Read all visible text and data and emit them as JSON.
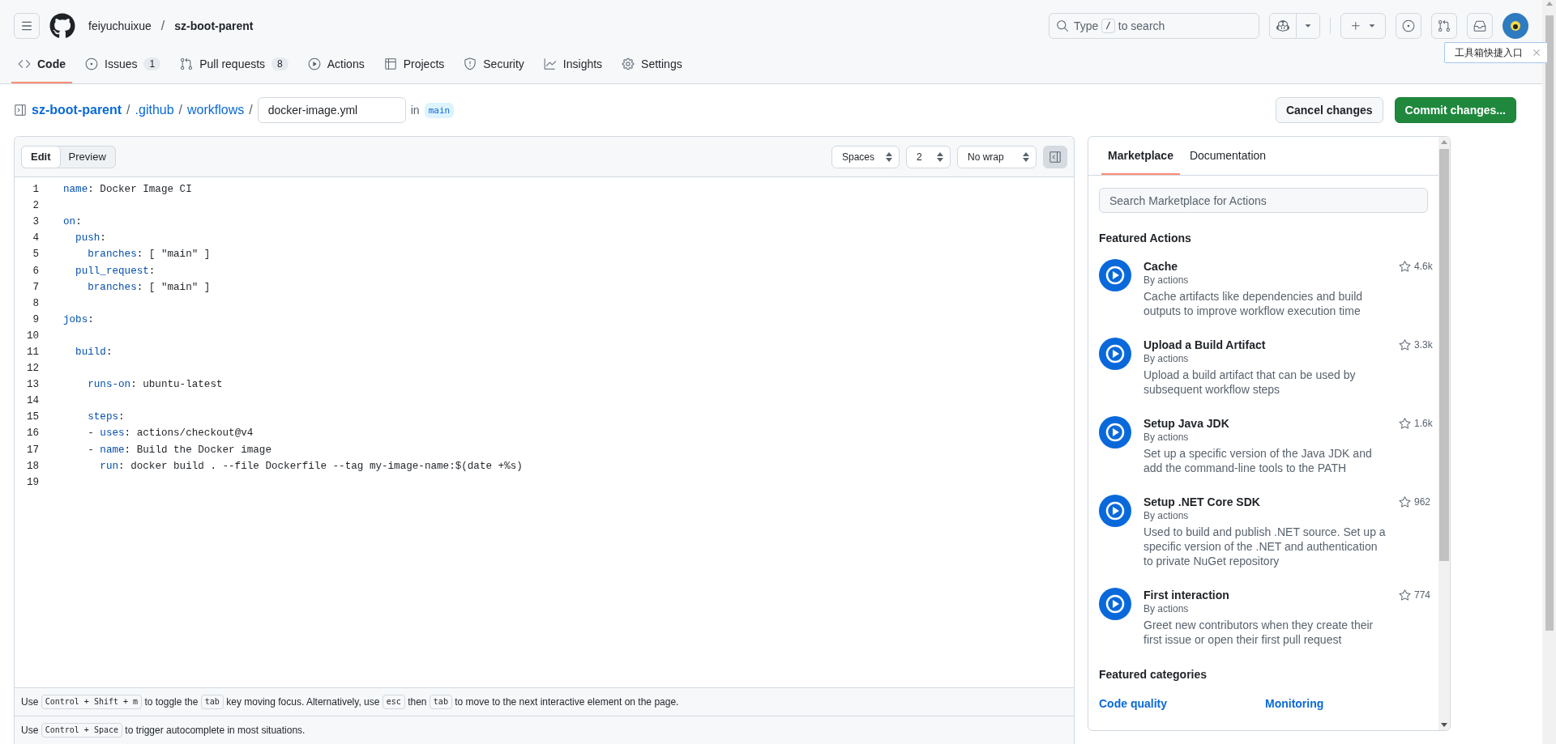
{
  "header": {
    "owner": "feiyuchuixue",
    "separator": "/",
    "repo": "sz-boot-parent",
    "search": {
      "placeholder_parts": [
        {
          "kind": "text",
          "text": "Type "
        },
        {
          "kind": "kbd",
          "text": "/"
        },
        {
          "kind": "text",
          "text": " to search"
        }
      ]
    }
  },
  "tooltip": {
    "text": "工具箱快捷入口"
  },
  "nav": [
    {
      "label": "Code",
      "selected": true
    },
    {
      "label": "Issues",
      "count": "1",
      "selected": false
    },
    {
      "label": "Pull requests",
      "count": "8",
      "selected": false
    },
    {
      "label": "Actions",
      "selected": false
    },
    {
      "label": "Projects",
      "selected": false
    },
    {
      "label": "Security",
      "selected": false
    },
    {
      "label": "Insights",
      "selected": false
    },
    {
      "label": "Settings",
      "selected": false
    }
  ],
  "breadcrumb": {
    "parts": [
      "sz-boot-parent",
      "/",
      ".github",
      "/",
      "workflows",
      "/"
    ],
    "filename": "docker-image.yml",
    "in_label": "in",
    "branch": "main"
  },
  "actions_buttons": [
    {
      "label": "Cancel changes",
      "kind": "default"
    },
    {
      "label": "Commit changes...",
      "kind": "primary"
    }
  ],
  "editor": {
    "modes": [
      {
        "label": "Edit",
        "selected": true
      },
      {
        "label": "Preview",
        "selected": false
      }
    ],
    "indent_mode": "Spaces",
    "indent_size": "2",
    "wrap_mode": "No wrap",
    "sidebar_toggle": {
      "pressed": true
    },
    "lines": [
      {
        "number": "1",
        "tokens": [
          {
            "kind": "key",
            "text": "name"
          },
          {
            "kind": "plain",
            "text": ": Docker Image CI"
          }
        ]
      },
      {
        "number": "2"
      },
      {
        "number": "3",
        "tokens": [
          {
            "kind": "key",
            "text": "on"
          },
          {
            "kind": "plain",
            "text": ":"
          }
        ]
      },
      {
        "number": "4",
        "tokens": [
          {
            "kind": "key",
            "text": "  push"
          },
          {
            "kind": "plain",
            "text": ":"
          }
        ]
      },
      {
        "number": "5",
        "tokens": [
          {
            "kind": "key",
            "text": "    branches"
          },
          {
            "kind": "plain",
            "text": ": [ \"main\" ]"
          }
        ]
      },
      {
        "number": "6",
        "tokens": [
          {
            "kind": "key",
            "text": "  pull_request"
          },
          {
            "kind": "plain",
            "text": ":"
          }
        ]
      },
      {
        "number": "7",
        "tokens": [
          {
            "kind": "key",
            "text": "    branches"
          },
          {
            "kind": "plain",
            "text": ": [ \"main\" ]"
          }
        ]
      },
      {
        "number": "8"
      },
      {
        "number": "9",
        "tokens": [
          {
            "kind": "key",
            "text": "jobs"
          },
          {
            "kind": "plain",
            "text": ":"
          }
        ]
      },
      {
        "number": "10"
      },
      {
        "number": "11",
        "tokens": [
          {
            "kind": "key",
            "text": "  build"
          },
          {
            "kind": "plain",
            "text": ":"
          }
        ]
      },
      {
        "number": "12"
      },
      {
        "number": "13",
        "tokens": [
          {
            "kind": "key",
            "text": "    runs-on"
          },
          {
            "kind": "plain",
            "text": ": ubuntu-latest"
          }
        ]
      },
      {
        "number": "14"
      },
      {
        "number": "15",
        "tokens": [
          {
            "kind": "key",
            "text": "    steps"
          },
          {
            "kind": "plain",
            "text": ":"
          }
        ]
      },
      {
        "number": "16",
        "tokens": [
          {
            "kind": "plain",
            "text": "    - "
          },
          {
            "kind": "key",
            "text": "uses"
          },
          {
            "kind": "plain",
            "text": ": actions/checkout@v4"
          }
        ]
      },
      {
        "number": "17",
        "tokens": [
          {
            "kind": "plain",
            "text": "    - "
          },
          {
            "kind": "key",
            "text": "name"
          },
          {
            "kind": "plain",
            "text": ": Build the Docker image"
          }
        ]
      },
      {
        "number": "18",
        "tokens": [
          {
            "kind": "key",
            "text": "      run"
          },
          {
            "kind": "plain",
            "text": ": docker build . --file Dockerfile --tag my-image-name:$(date +%s)"
          }
        ]
      },
      {
        "number": "19"
      }
    ],
    "hints": [
      [
        {
          "kind": "text",
          "text": "Use "
        },
        {
          "kind": "kbd",
          "text": "Control + Shift + m"
        },
        {
          "kind": "text",
          "text": " to toggle the "
        },
        {
          "kind": "kbd",
          "text": "tab"
        },
        {
          "kind": "text",
          "text": " key moving focus. Alternatively, use "
        },
        {
          "kind": "kbd",
          "text": "esc"
        },
        {
          "kind": "text",
          "text": " then "
        },
        {
          "kind": "kbd",
          "text": "tab"
        },
        {
          "kind": "text",
          "text": " to move to the next interactive element on the page."
        }
      ],
      [
        {
          "kind": "text",
          "text": "Use "
        },
        {
          "kind": "kbd",
          "text": "Control + Space"
        },
        {
          "kind": "text",
          "text": " to trigger autocomplete in most situations."
        }
      ]
    ]
  },
  "sidebar": {
    "tabs": [
      {
        "label": "Marketplace",
        "selected": true
      },
      {
        "label": "Documentation",
        "selected": false
      }
    ],
    "search": {
      "placeholder": "Search Marketplace for Actions"
    },
    "featured_title": "Featured Actions",
    "actions": [
      {
        "title": "Cache",
        "author": "By actions",
        "description": "Cache artifacts like dependencies and build outputs to improve workflow execution time",
        "count": "4.6k"
      },
      {
        "title": "Upload a Build Artifact",
        "author": "By actions",
        "description": "Upload a build artifact that can be used by subsequent workflow steps",
        "count": "3.3k"
      },
      {
        "title": "Setup Java JDK",
        "author": "By actions",
        "description": "Set up a specific version of the Java JDK and add the command-line tools to the PATH",
        "count": "1.6k"
      },
      {
        "title": "Setup .NET Core SDK",
        "author": "By actions",
        "description": "Used to build and publish .NET source. Set up a specific version of the .NET and authentication to private NuGet repository",
        "count": "962"
      },
      {
        "title": "First interaction",
        "author": "By actions",
        "description": "Greet new contributors when they create their first issue or open their first pull request",
        "count": "774"
      }
    ],
    "categories_title": "Featured categories",
    "categories": [
      "Code quality",
      "Monitoring"
    ]
  }
}
